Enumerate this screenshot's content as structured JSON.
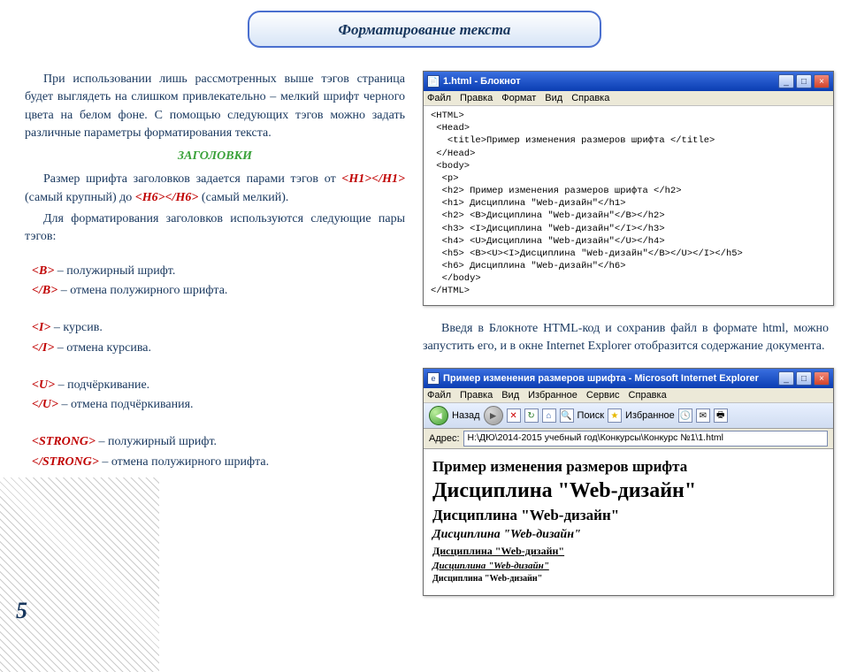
{
  "banner": {
    "title": "Форматирование текста"
  },
  "left": {
    "p1": "При использовании лишь рассмотренных выше тэгов страница будет выглядеть на слишком привлекательно – мелкий шрифт черного цвета на белом фоне. С помощью следующих тэгов можно задать различные параметры форматирования текста.",
    "section": "ЗАГОЛОВКИ",
    "p2a": "Размер шрифта заголовков задается парами тэгов от ",
    "h1open": "<H1>",
    "h1close": "</H1>",
    "p2b": " (самый крупный) до ",
    "h6open": "<H6>",
    "h6close": "</H6>",
    "p2c": " (самый мелкий).",
    "p3": "Для форматирования заголовков используются следующие  пары тэгов:",
    "tags": [
      {
        "open": "<B>",
        "open_desc": "  – полужирный шрифт.",
        "close": "</B>",
        "close_desc": "  – отмена полужирного шрифта."
      },
      {
        "open": "<I>",
        "open_desc": "  – курсив.",
        "close": "</I>",
        "close_desc": "  – отмена курсива."
      },
      {
        "open": "<U>",
        "open_desc": "  – подчёркивание.",
        "close": "</U>",
        "close_desc": "  – отмена подчёркивания."
      },
      {
        "open": "<STRONG>",
        "open_desc": "  – полужирный шрифт.",
        "close": "</STRONG>",
        "close_desc": "  –  отмена полужирного шрифта."
      }
    ]
  },
  "notepad": {
    "title": "1.html - Блокнот",
    "menu": [
      "Файл",
      "Правка",
      "Формат",
      "Вид",
      "Справка"
    ],
    "code": "<HTML>\n <Head>\n   <title>Пример изменения размеров шрифта </title>\n </Head>\n <body>\n  <p>\n  <h2> Пример изменения размеров шрифта </h2>\n  <h1> Дисциплина \"Web-дизайн\"</h1>\n  <h2> <B>Дисциплина \"Web-дизайн\"</B></h2>\n  <h3> <I>Дисциплина \"Web-дизайн\"</I></h3>\n  <h4> <U>Дисциплина \"Web-дизайн\"</U></h4>\n  <h5> <B><U><I>Дисциплина \"Web-дизайн\"</B></U></I></h5>\n  <h6> Дисциплина \"Web-дизайн\"</h6>\n  </body>\n</HTML>"
  },
  "right_text": "Введя в Блокноте HTML-код  и сохранив файл в формате html, можно запустить его, и в окне Internet Explorer отобразится содержание документа.",
  "ie": {
    "title": "Пример изменения размеров шрифта - Microsoft Internet Explorer",
    "menu": [
      "Файл",
      "Правка",
      "Вид",
      "Избранное",
      "Сервис",
      "Справка"
    ],
    "toolbar": {
      "back": "Назад",
      "search": "Поиск",
      "fav": "Избранное"
    },
    "addr_label": "Адрес:",
    "addr": "H:\\ДЮ\\2014-2015 учебный год\\Конкурсы\\Конкурс №1\\1.html",
    "body": {
      "h2": "Пример изменения размеров шрифта",
      "h1": "Дисциплина \"Web-дизайн\"",
      "h2b": "Дисциплина \"Web-дизайн\"",
      "h3": "Дисциплина \"Web-дизайн\"",
      "h4": "Дисциплина \"Web-дизайн\"",
      "h5": "Дисциплина \"Web-дизайн\"",
      "h6": "Дисциплина \"Web-дизайн\""
    }
  },
  "pagenum": "5"
}
